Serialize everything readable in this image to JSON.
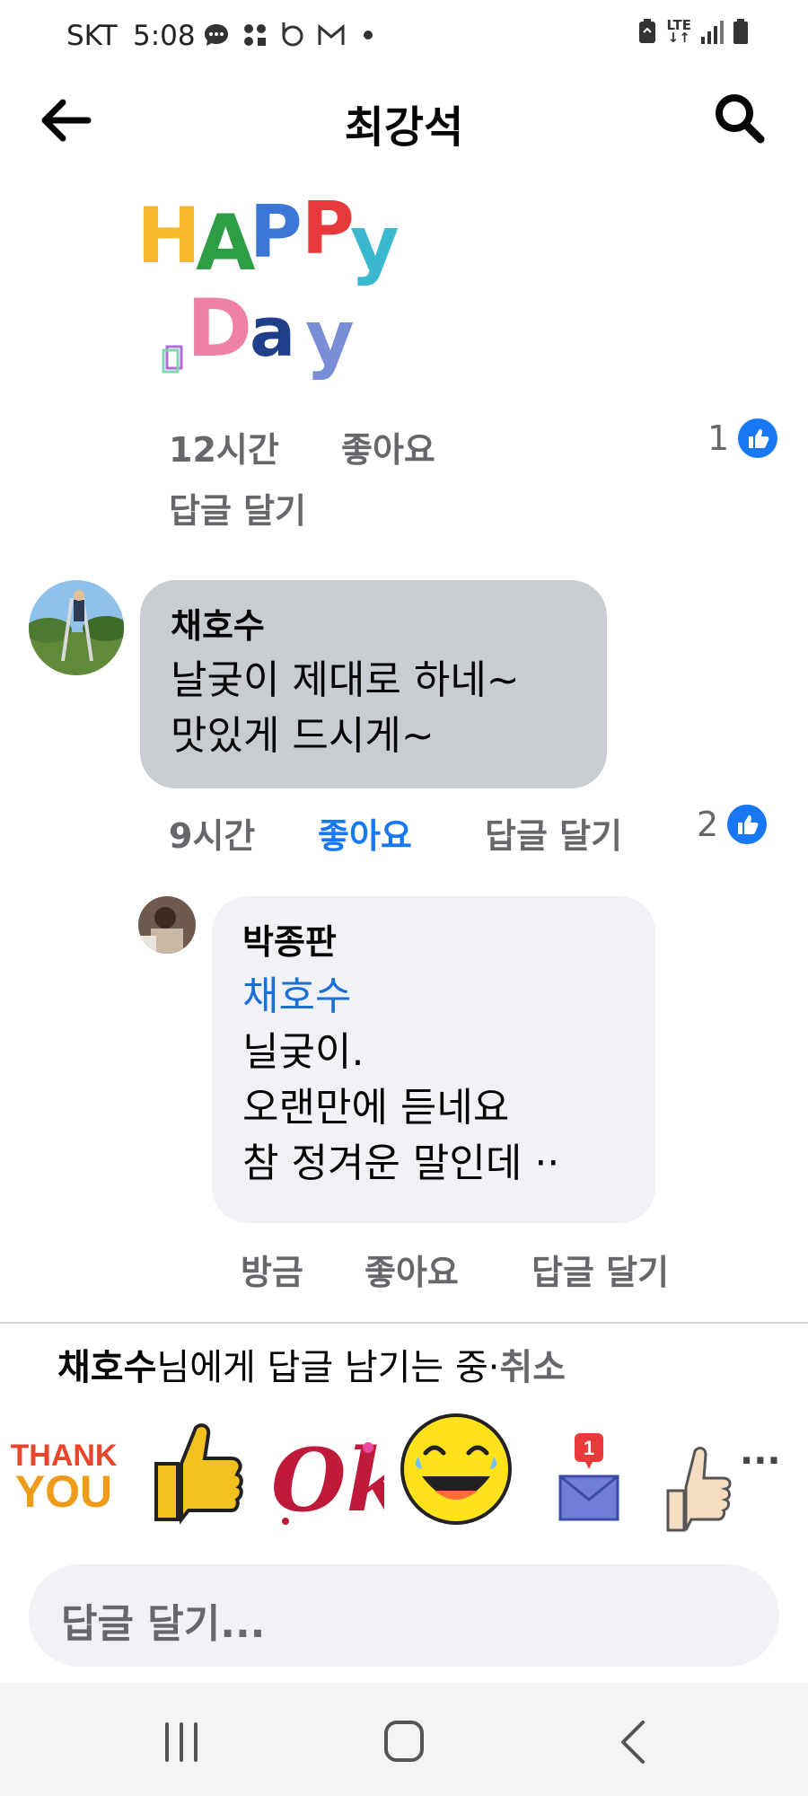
{
  "status_bar": {
    "carrier": "SKT",
    "time": "5:08",
    "notification_icons": [
      "chat-bubble-icon",
      "app-grid-icon",
      "band-icon",
      "gmail-icon",
      "dot-icon"
    ],
    "network_label": "LTE",
    "right_icons": [
      "battery-saver-icon",
      "lte-icon",
      "signal-icon",
      "battery-icon"
    ]
  },
  "header": {
    "title": "최강석",
    "back_icon": "back-arrow-icon",
    "search_icon": "search-icon"
  },
  "sticker_comment": {
    "sticker_text": [
      "HAPPY",
      "Day"
    ],
    "time": "12시간",
    "like_label": "좋아요",
    "reply_label": "답글 달기",
    "reaction_count": "1"
  },
  "comment": {
    "author": "채호수",
    "text": "날궂이 제대로 하네~\n맛있게 드시게~",
    "time": "9시간",
    "like_label": "좋아요",
    "like_state": "liked",
    "reply_label": "답글 달기",
    "reaction_count": "2"
  },
  "reply": {
    "author": "박종판",
    "mention": "채호수",
    "text": "닐궂이.\n오랜만에 듣네요\n참 정겨운 말인데 ··",
    "time": "방금",
    "like_label": "좋아요",
    "reply_label": "답글 달기"
  },
  "replying_banner": {
    "name": "채호수",
    "suffix": "님에게 답글 남기는 중",
    "separator": "·",
    "cancel_label": "취소"
  },
  "stickers": {
    "thank_you_lines": [
      "THANK",
      "YOU"
    ],
    "ok_text": "Ok",
    "mail_badge": "1",
    "more_label": "···"
  },
  "composer": {
    "placeholder": "답글 달기..."
  },
  "nav_bar": {
    "icons": [
      "recent-apps-icon",
      "home-icon",
      "back-icon"
    ]
  },
  "colors": {
    "accent": "#1877f2",
    "bubble_gray": "#c9ccd1",
    "bubble_light": "#f0f2f5",
    "meta_text": "#65676b"
  }
}
